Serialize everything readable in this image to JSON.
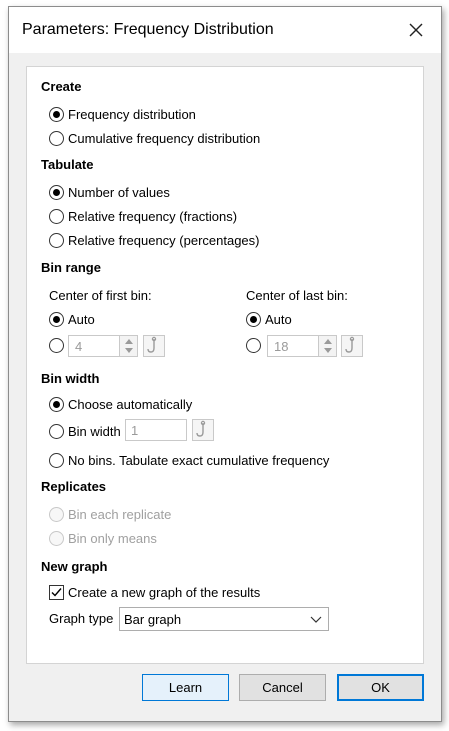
{
  "dialog": {
    "title": "Parameters: Frequency Distribution",
    "close_icon": "close-icon"
  },
  "create": {
    "heading": "Create",
    "options": [
      "Frequency distribution",
      "Cumulative frequency distribution"
    ],
    "selected": 0
  },
  "tabulate": {
    "heading": "Tabulate",
    "options": [
      "Number of values",
      "Relative frequency (fractions)",
      "Relative frequency (percentages)"
    ],
    "selected": 0
  },
  "bin_range": {
    "heading": "Bin range",
    "first_label": "Center of first bin:",
    "last_label": "Center of last bin:",
    "auto_label": "Auto",
    "first_value": "4",
    "last_value": "18"
  },
  "bin_width": {
    "heading": "Bin width",
    "choose_auto": "Choose automatically",
    "bin_width_label": "Bin width",
    "bin_width_value": "1",
    "no_bins": "No bins. Tabulate exact cumulative frequency"
  },
  "replicates": {
    "heading": "Replicates",
    "options": [
      "Bin each replicate",
      "Bin only means"
    ]
  },
  "new_graph": {
    "heading": "New graph",
    "create_label": "Create a new graph of the results",
    "checked": true,
    "graph_type_label": "Graph type",
    "graph_type_value": "Bar graph"
  },
  "buttons": {
    "learn": "Learn",
    "cancel": "Cancel",
    "ok": "OK"
  },
  "colors": {
    "accent": "#0078d7",
    "disabled_text": "#a0a0a0"
  }
}
